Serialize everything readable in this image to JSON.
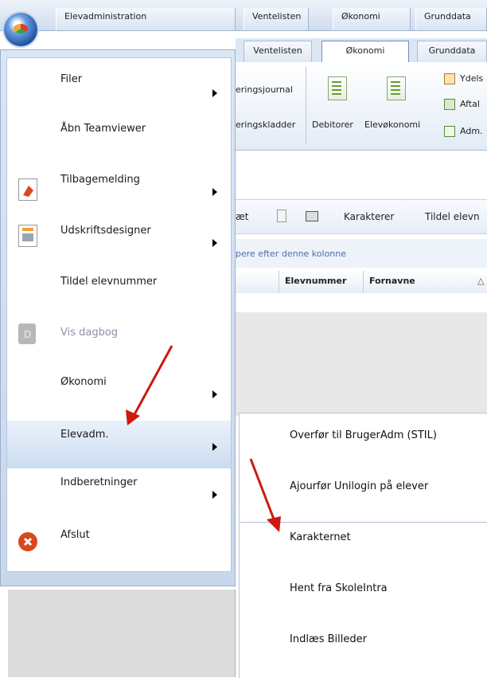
{
  "top_tabs": [
    "Elevadministration",
    "Ventelisten",
    "Økonomi",
    "Grunddata"
  ],
  "ribbon_tabs": [
    "Ventelisten",
    "Økonomi",
    "Grunddata"
  ],
  "ribbon_tab_active": "Økonomi",
  "ribbon": {
    "journal_label": "eringsjournal",
    "kladder_label": "eringskladder",
    "debitorer_label": "Debitorer",
    "elevokonomi_label": "Elevøkonomi",
    "small_items": [
      "Ydels",
      "Aftal",
      "Adm."
    ]
  },
  "toolbar": {
    "partial_label": "æt",
    "karakterer_label": "Karakterer",
    "tildel_label": "Tildel elevn"
  },
  "group_hint": "pere efter denne kolonne",
  "grid": {
    "columns": [
      "Elevnummer",
      "Fornavne"
    ],
    "sort_glyph": "△"
  },
  "menu": {
    "items": [
      {
        "label": "Filer",
        "has_submenu": true,
        "disabled": false
      },
      {
        "label": "Åbn Teamviewer",
        "has_submenu": false,
        "disabled": false
      },
      {
        "label": "Tilbagemelding",
        "has_submenu": true,
        "disabled": false
      },
      {
        "label": "Udskriftsdesigner",
        "has_submenu": true,
        "disabled": false
      },
      {
        "label": "Tildel elevnummer",
        "has_submenu": false,
        "disabled": false
      },
      {
        "label": "Vis dagbog",
        "has_submenu": false,
        "disabled": true
      },
      {
        "label": "Økonomi",
        "has_submenu": true,
        "disabled": false
      },
      {
        "label": "Elevadm.",
        "has_submenu": true,
        "disabled": false,
        "highlighted": true
      },
      {
        "label": "Indberetninger",
        "has_submenu": true,
        "disabled": false
      },
      {
        "label": "Afslut",
        "has_submenu": false,
        "disabled": false
      }
    ]
  },
  "submenu": {
    "items": [
      "Overfør til BrugerAdm (STIL)",
      "Ajourfør Unilogin på elever",
      "Karakternet",
      "Hent fra SkoleIntra",
      "Indlæs Billeder"
    ]
  },
  "colors": {
    "accent": "#c9daf0",
    "annotation_arrow": "#cc1a10",
    "exit_icon": "#d9481c"
  }
}
